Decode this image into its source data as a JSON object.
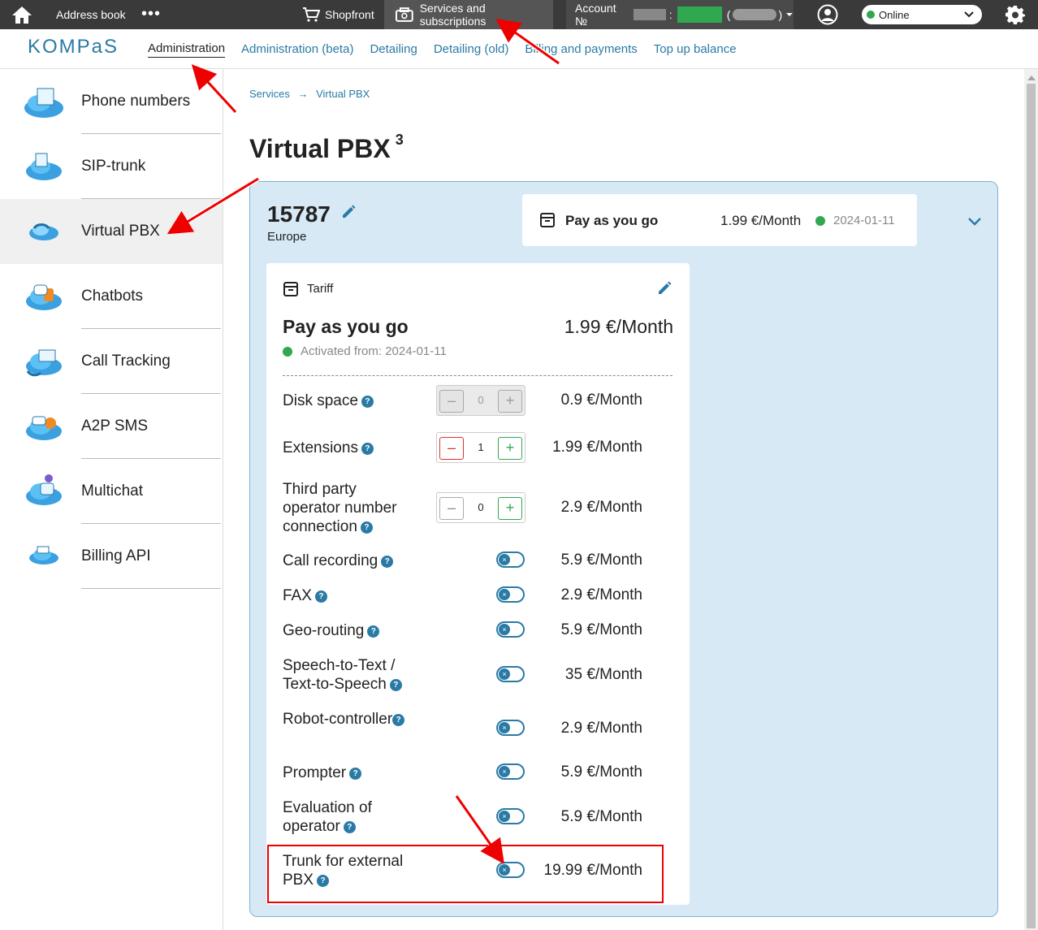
{
  "topbar": {
    "address_book": "Address book",
    "more": "•••",
    "shopfront": "Shopfront",
    "services": "Services and subscriptions",
    "account_prefix": "Account №",
    "account_sep": ":",
    "account_open": "(",
    "account_close": ")",
    "status": "Online"
  },
  "logo": "KOMPaS",
  "nav": [
    "Administration",
    "Administration (beta)",
    "Detailing",
    "Detailing (old)",
    "Billing and payments",
    "Top up balance"
  ],
  "sidebar": {
    "items": [
      {
        "label": "Phone numbers",
        "icon": "phone-numbers-cloud-icon"
      },
      {
        "label": "SIP-trunk",
        "icon": "sip-trunk-cloud-icon"
      },
      {
        "label": "Virtual PBX",
        "icon": "virtual-pbx-cloud-icon"
      },
      {
        "label": "Chatbots",
        "icon": "chatbots-cloud-icon"
      },
      {
        "label": "Call Tracking",
        "icon": "call-tracking-cloud-icon"
      },
      {
        "label": "A2P SMS",
        "icon": "a2p-sms-cloud-icon"
      },
      {
        "label": "Multichat",
        "icon": "multichat-cloud-icon"
      },
      {
        "label": "Billing API",
        "icon": "billing-api-cloud-icon"
      }
    ]
  },
  "breadcrumb": {
    "first": "Services",
    "arrow": "→",
    "second": "Virtual PBX"
  },
  "page": {
    "title": "Virtual PBX",
    "count": "3"
  },
  "pbx": {
    "number": "15787",
    "region": "Europe",
    "summary": {
      "name": "Pay as you go",
      "price": "1.99 €/Month",
      "date": "2024-01-11"
    }
  },
  "tariff": {
    "label": "Tariff",
    "plan": "Pay as you go",
    "price": "1.99 €/Month",
    "activated": "Activated from: 2024-01-11",
    "options": [
      {
        "label": "Disk space",
        "price": "0.9 €/Month",
        "control": "stepper",
        "value": "0",
        "disabled": true
      },
      {
        "label": "Extensions",
        "price": "1.99 €/Month",
        "control": "stepper",
        "value": "1",
        "disabled": false
      },
      {
        "label": "Third party operator number connection",
        "price": "2.9 €/Month",
        "control": "stepper",
        "value": "0",
        "disabled": false
      },
      {
        "label": "Call recording",
        "price": "5.9 €/Month",
        "control": "toggle",
        "enabled": false
      },
      {
        "label": "FAX",
        "price": "2.9 €/Month",
        "control": "toggle",
        "enabled": false
      },
      {
        "label": "Geo-routing",
        "price": "5.9 €/Month",
        "control": "toggle",
        "enabled": false
      },
      {
        "label": "Speech-to-Text / Text-to-Speech",
        "price": "35 €/Month",
        "control": "toggle",
        "enabled": false
      },
      {
        "label": "Robot-controller",
        "price": "2.9 €/Month",
        "control": "toggle",
        "enabled": false
      },
      {
        "label": "Prompter",
        "price": "5.9 €/Month",
        "control": "toggle",
        "enabled": false
      },
      {
        "label": "Evaluation of operator",
        "price": "5.9 €/Month",
        "control": "toggle",
        "enabled": false
      },
      {
        "label": "Trunk for external PBX",
        "price": "19.99 €/Month",
        "control": "toggle",
        "enabled": false
      }
    ]
  },
  "colors": {
    "accent": "#2a7aa6",
    "card_bg": "#d6e9f5",
    "online": "#2fa84f",
    "annotation": "#e00000"
  }
}
